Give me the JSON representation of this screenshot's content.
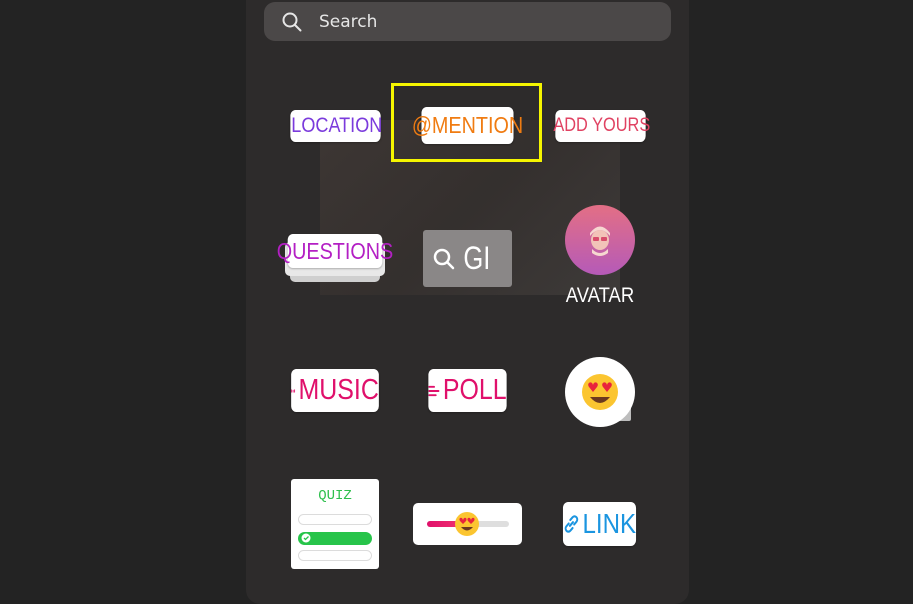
{
  "search": {
    "label": "Search"
  },
  "stickers": {
    "location": "LOCATION",
    "mention": "@MENTION",
    "add_yours": "ADD YOURS",
    "questions": "QUESTIONS",
    "gif": "GI",
    "avatar": "AVATAR",
    "music": "MUSIC",
    "poll": "POLL",
    "quiz": "QUIZ",
    "link": "LINK"
  },
  "colors": {
    "location": "#7b3bdc",
    "mention": "#f07c12",
    "add_yours": "#e04262",
    "questions": "#b31fc4",
    "music": "#e0106b",
    "poll": "#e0106b",
    "quiz": "#2dbf4c",
    "link": "#1b95e0",
    "highlight": "#f5f500"
  },
  "icons": {
    "search": "search-icon",
    "location": "location-pin-icon",
    "add_yours": "camera-icon",
    "gif_search": "search-icon",
    "music": "music-bars-icon",
    "poll": "poll-lines-icon",
    "emoji": "heart-eyes-emoji-icon",
    "link": "link-icon",
    "quiz_check": "check-icon",
    "slider_emoji": "heart-eyes-emoji-icon"
  }
}
